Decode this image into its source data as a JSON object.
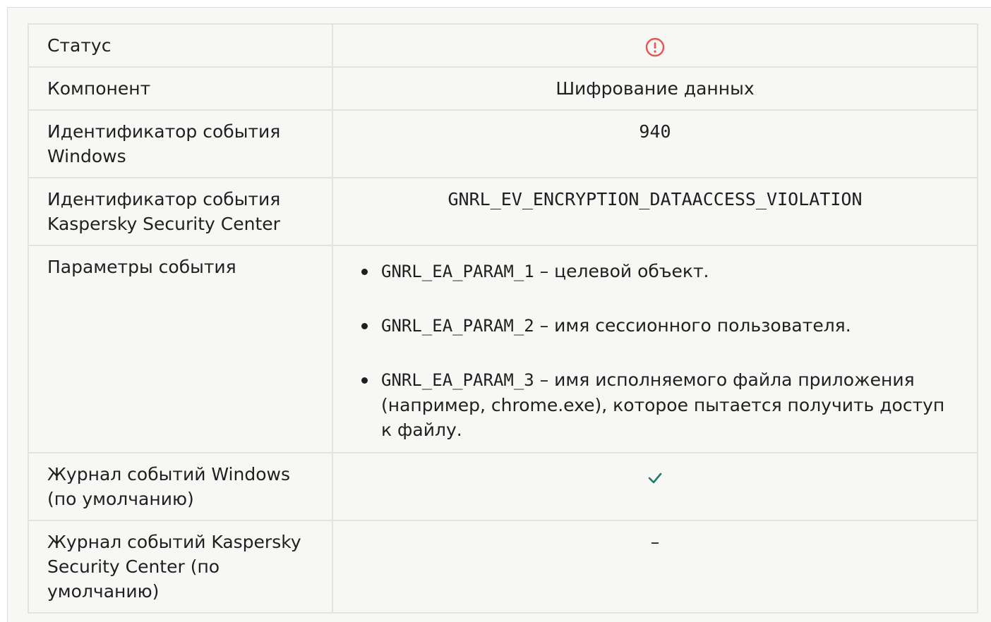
{
  "rows": {
    "status": {
      "label": "Статус",
      "icon": "error-icon",
      "icon_color": "#e8554f"
    },
    "component": {
      "label": "Компонент",
      "value": "Шифрование данных"
    },
    "windows_event_id": {
      "label": "Идентификатор события Windows",
      "value": "940"
    },
    "ksc_event_id": {
      "label": "Идентификатор события Kaspersky Security Center",
      "value": "GNRL_EV_ENCRYPTION_DATAACCESS_VIOLATION"
    },
    "event_params": {
      "label": "Параметры события",
      "items": [
        {
          "code": "GNRL_EA_PARAM_1",
          "text": " – целевой объект."
        },
        {
          "code": "GNRL_EA_PARAM_2",
          "text": " – имя сессионного пользователя."
        },
        {
          "code": "GNRL_EA_PARAM_3",
          "text": " – имя исполняемого файла приложения (например, chrome.exe), которое пытается получить доступ к файлу."
        }
      ]
    },
    "windows_log": {
      "label": "Журнал событий Windows (по умолчанию)",
      "icon": "check-icon",
      "icon_color": "#1f7a6a"
    },
    "ksc_log": {
      "label": "Журнал событий Kaspersky Security Center (по умолчанию)",
      "value": "–"
    }
  }
}
